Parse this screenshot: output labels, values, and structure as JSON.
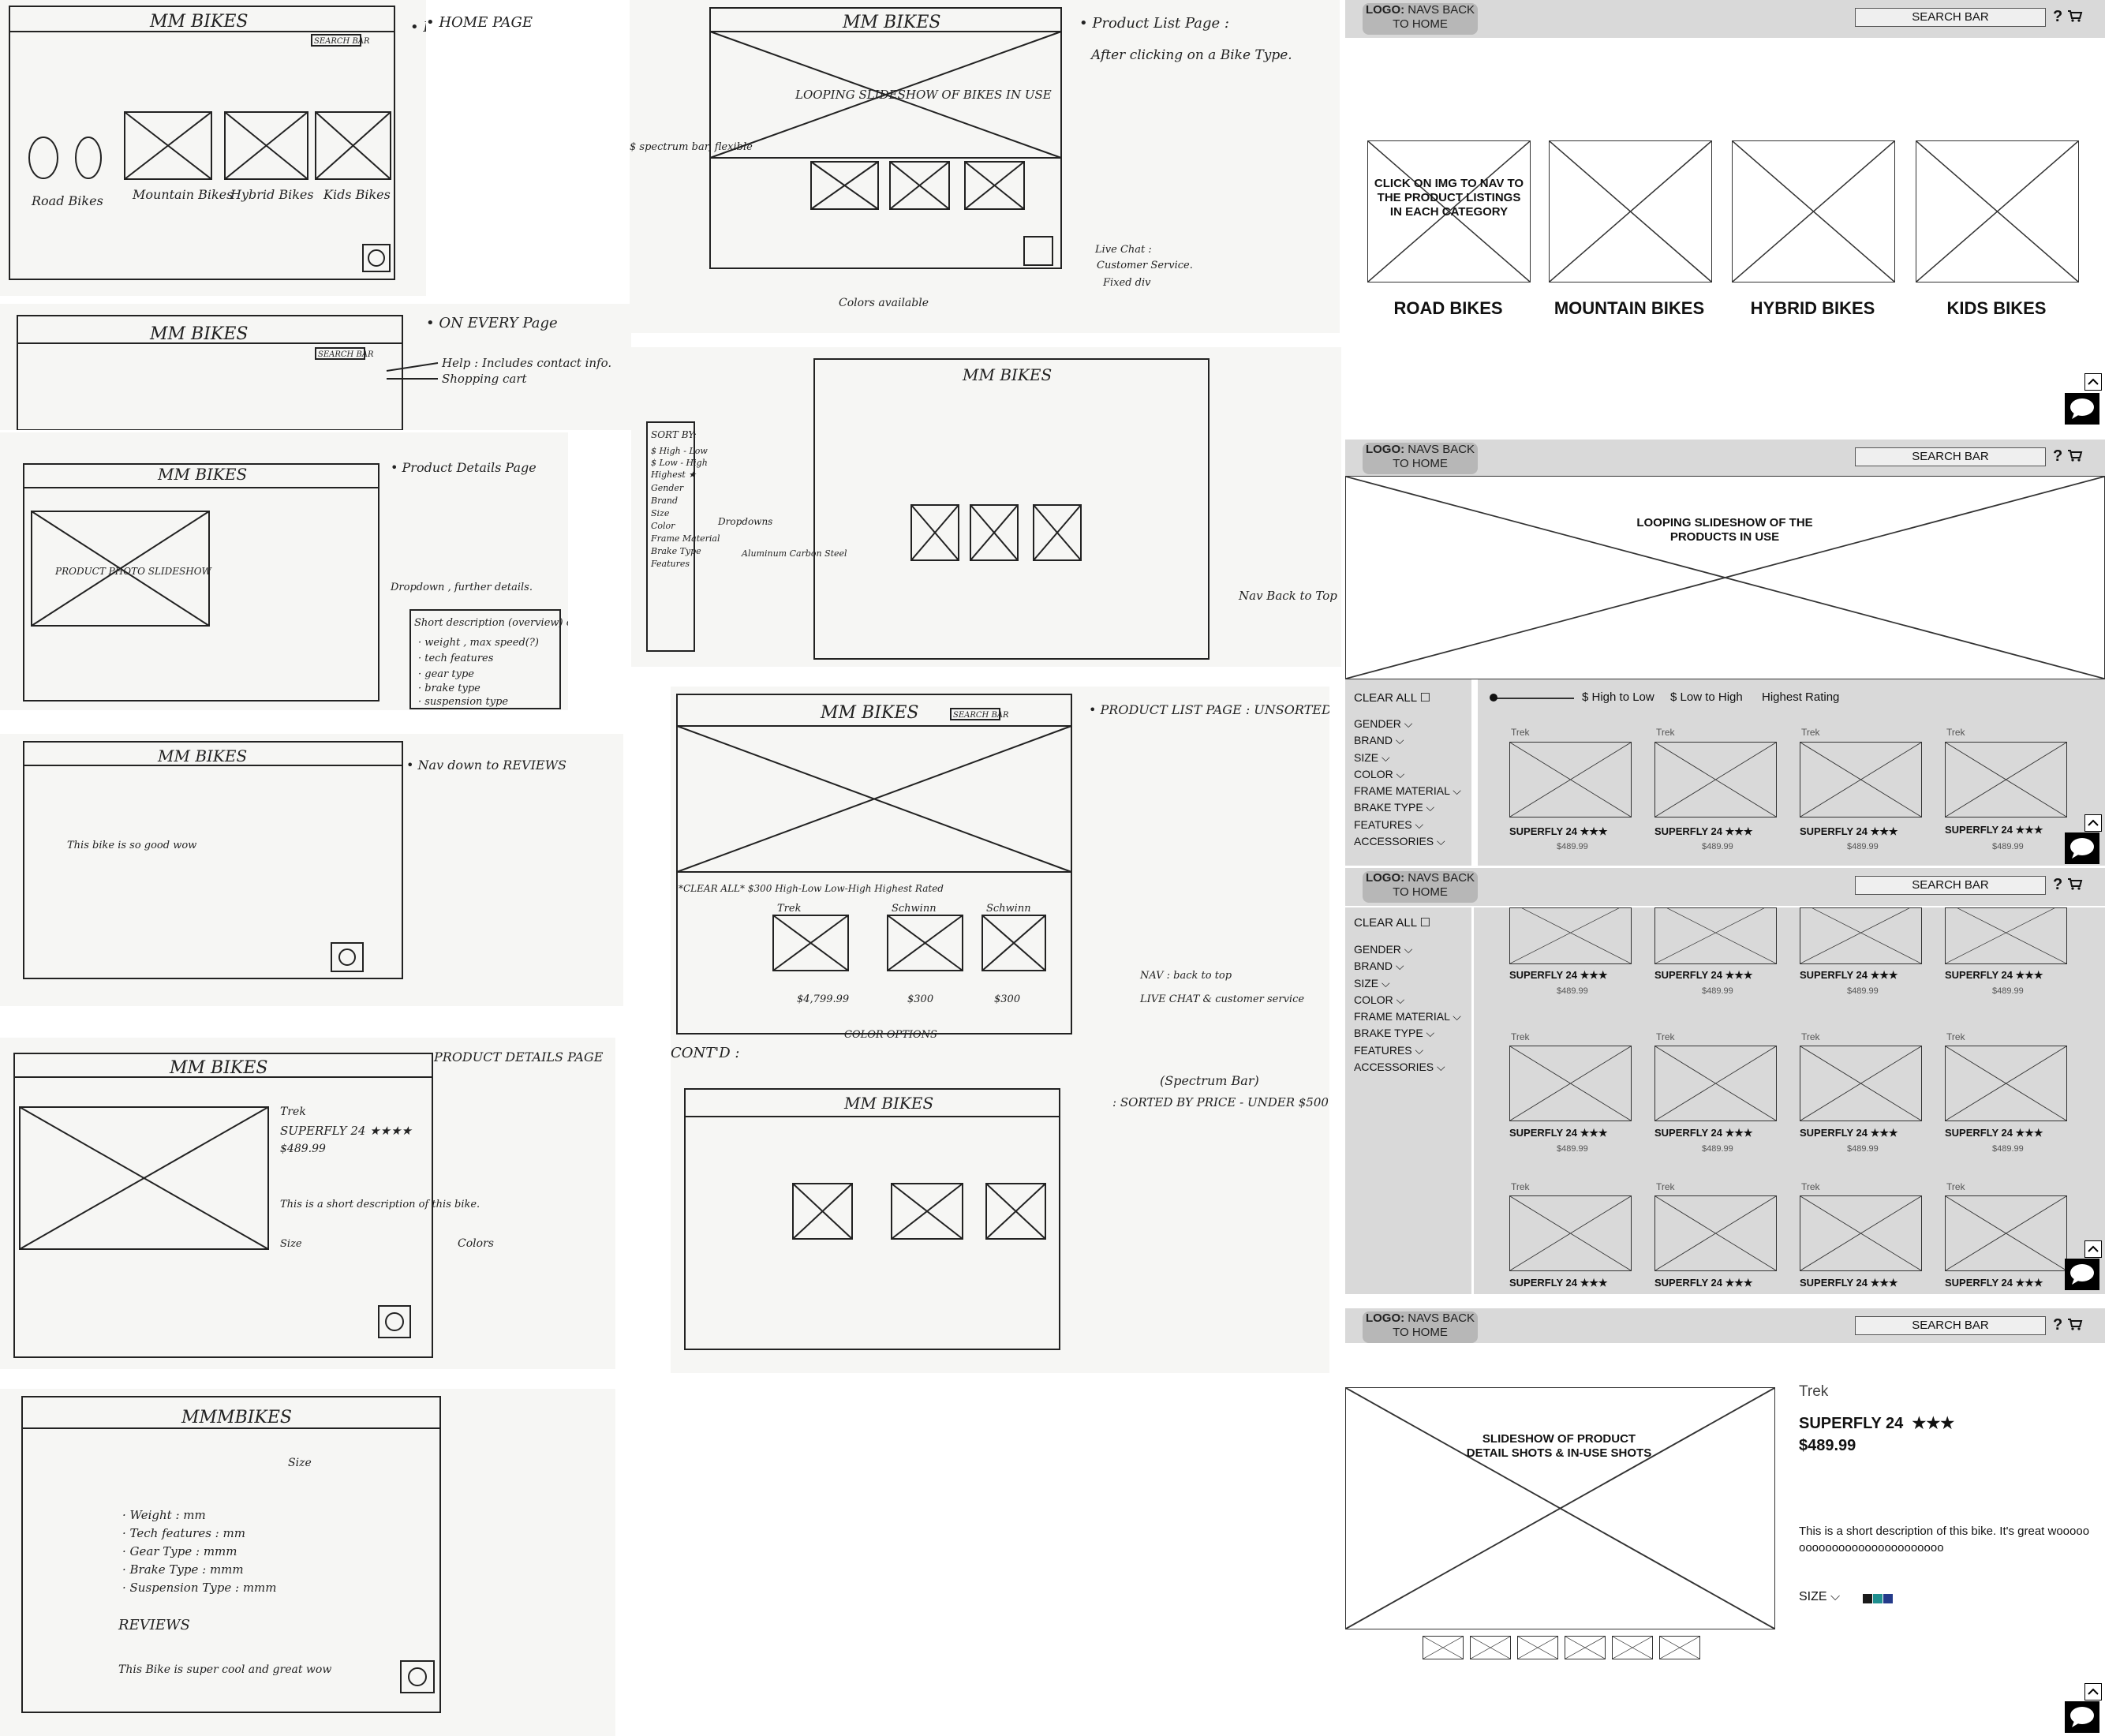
{
  "sketches": {
    "home": {
      "title": "MM BIKES",
      "search": "SEARCH BAR",
      "note": "• HOME PAGE",
      "labels": [
        "Road Bikes",
        "Mountain Bikes",
        "Hybrid Bikes",
        "Kids Bikes"
      ]
    },
    "every": {
      "title": "MM BIKES",
      "search": "SEARCH BAR",
      "note": "• ON EVERY Page",
      "help": "Help : Includes contact info.",
      "cart": "Shopping cart"
    },
    "list1": {
      "title": "MM BIKES",
      "slideshow": "LOOPING SLIDESHOW OF BIKES IN USE",
      "note1": "• Product List Page :",
      "note2": "After clicking on a Bike Type.",
      "spectrum": "$ spectrum bar, flexible",
      "chat1": "Live Chat :",
      "chat2": "Customer Service.",
      "chat3": "Fixed div",
      "colors": "Colors available"
    },
    "details1": {
      "title": "MM BIKES",
      "note": "• Product Details Page",
      "photo": "PRODUCT PHOTO SLIDESHOW",
      "dropdown": "Dropdown , further details.",
      "d1": "Short description (overview) of the bike... V",
      "d2": "· weight , max speed(?)",
      "d3": "· tech features",
      "d4": "· gear type",
      "d5": "· brake type",
      "d6": "· suspension type"
    },
    "list2": {
      "title": "MM BIKES",
      "dropdowns": "Dropdowns",
      "materials": "Aluminum Carbon Steel",
      "nav": "Nav Back to Top",
      "filters": [
        "SORT BY:",
        "$ High - Low",
        "$ Low - High",
        "Highest ★",
        "Gender",
        "Brand",
        "Size",
        "Color",
        "Frame Material",
        "Brake Type",
        "Features"
      ]
    },
    "reviews": {
      "title": "MM BIKES",
      "note": "• Nav down to REVIEWS",
      "review": "This bike is so good wow"
    },
    "unsorted": {
      "title": "MM BIKES",
      "search": "SEARCH BAR",
      "note": "• PRODUCT LIST PAGE : UNSORTED",
      "nav": "NAV : back to top",
      "chat": "LIVE CHAT & customer service",
      "colors": "COLOR OPTIONS",
      "brands": [
        "Trek",
        "Schwinn",
        "Schwinn"
      ],
      "prices": [
        "$4,799.99",
        "$300",
        "$300"
      ],
      "sort": "*CLEAR ALL*   $300   High-Low   Low-High  Highest Rated",
      "cont": "CONT'D :",
      "spectrum": "(Spectrum Bar)",
      "sorted": ": SORTED BY PRICE - UNDER $500"
    },
    "details2": {
      "title": "MM BIKES",
      "note": "PRODUCT DETAILS PAGE",
      "brand": "Trek",
      "name": "SUPERFLY 24 ★★★★",
      "price": "$489.99",
      "desc": "This is a short description of this bike.",
      "size": "Size",
      "colors": "Colors"
    },
    "details3": {
      "title": "MMMBIKES",
      "size": "Size",
      "specs": [
        "· Weight : mm",
        "· Tech features : mm",
        "· Gear Type : mmm",
        "· Brake Type : mmm",
        "· Suspension Type : mmm"
      ],
      "reviews": "REVIEWS",
      "review": "This Bike is super cool and great wow"
    }
  },
  "wireframes": {
    "logo_bold": "LOGO:",
    "logo_rest": "NAVS BACK TO HOME",
    "search": "SEARCH BAR",
    "help": "?",
    "home": {
      "overlay": "CLICK ON IMG TO NAV TO THE PRODUCT LISTINGS IN EACH CATEGORY",
      "categories": [
        "ROAD BIKES",
        "MOUNTAIN BIKES",
        "HYBRID BIKES",
        "KIDS BIKES"
      ]
    },
    "list": {
      "slideshow": "LOOPING SLIDESHOW OF THE PRODUCTS IN USE",
      "clear": "CLEAR ALL",
      "filters": [
        "GENDER",
        "BRAND",
        "SIZE",
        "COLOR",
        "FRAME MATERIAL",
        "BRAKE TYPE",
        "FEATURES",
        "ACCESSORIES"
      ],
      "sort": [
        "$ High to Low",
        "$ Low to High",
        "Highest Rating"
      ],
      "brand": "Trek",
      "product": "SUPERFLY 24",
      "stars": "★★★",
      "price": "$489.99"
    },
    "detail": {
      "slideshow": "SLIDESHOW OF PRODUCT DETAIL SHOTS & IN-USE SHOTS",
      "brand": "Trek",
      "product": "SUPERFLY 24",
      "stars": "★★★",
      "price": "$489.99",
      "description": "This is a short description of this bike. It's great wooooooooooooooooooooooooooo",
      "size": "SIZE"
    },
    "colors": {
      "header": "#d9d9d9",
      "logo": "#b7b7b7",
      "swatch1": "#1a1a1a",
      "swatch2": "#1f8f8f",
      "swatch3": "#243a8a"
    }
  }
}
